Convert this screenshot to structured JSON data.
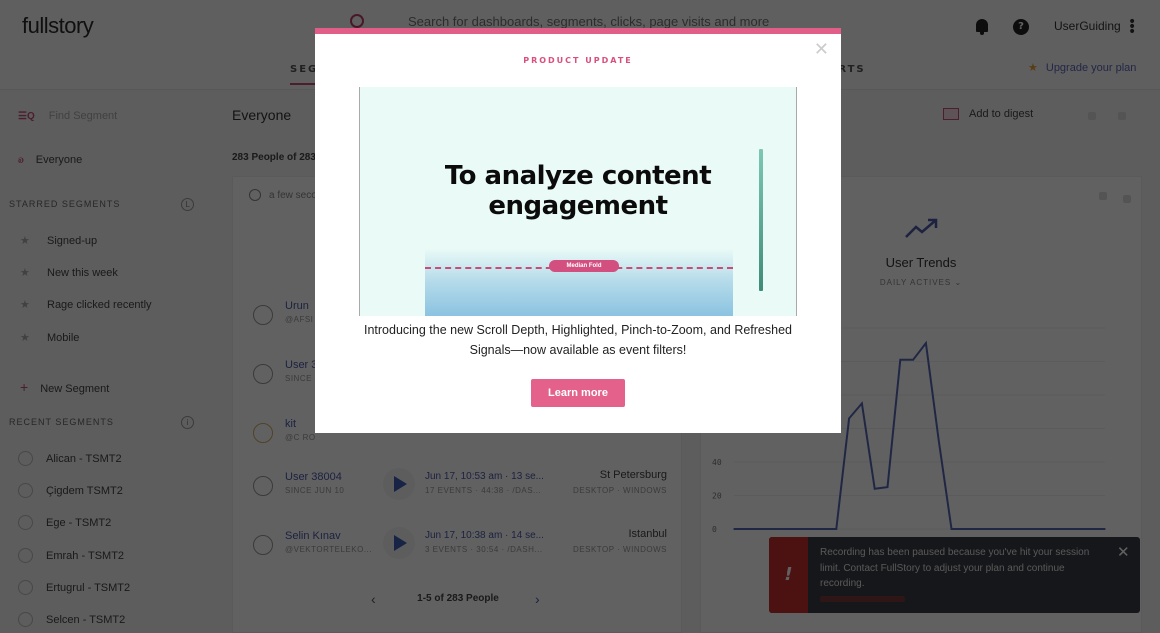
{
  "header": {
    "logo": "fullstory",
    "search_placeholder": "Search for dashboards, segments, clicks, page visits and more",
    "user_name": "UserGuiding",
    "tabs": [
      {
        "label": "SEGMENTS",
        "active": true
      },
      {
        "label": "REPORTS",
        "active": false
      }
    ],
    "upgrade_label": "Upgrade your plan"
  },
  "sidebar": {
    "find_placeholder": "Find Segment",
    "everyone_label": "Everyone",
    "starred_heading": "STARRED SEGMENTS",
    "starred": [
      "Signed-up",
      "New this week",
      "Rage clicked recently",
      "Mobile"
    ],
    "new_segment_label": "New Segment",
    "recent_heading": "RECENT SEGMENTS",
    "recent": [
      "Alican - TSMT2",
      "Çigdem TSMT2",
      "Ege - TSMT2",
      "Emrah - TSMT2",
      "Ertugrul - TSMT2",
      "Selcen - TSMT2"
    ]
  },
  "main": {
    "segment_title": "Everyone",
    "people_count": "283 People of 283",
    "last_updated": "a few seconds ago",
    "rows": [
      {
        "name": "Urun",
        "sub": "@AFSI",
        "time": "",
        "events": "",
        "city": "",
        "device": ""
      },
      {
        "name": "User 3",
        "sub": "SINCE J",
        "time": "",
        "events": "",
        "city": "",
        "device": ""
      },
      {
        "name": "kit",
        "sub": "@C RO",
        "time": "",
        "events": "",
        "city": "",
        "device": ""
      },
      {
        "name": "User 38004",
        "sub": "SINCE JUN 10",
        "time": "Jun 17, 10:53 am · 13 se...",
        "events": "17 EVENTS · 44:38 · /DAS...",
        "city": "St Petersburg",
        "device": "DESKTOP · WINDOWS"
      },
      {
        "name": "Selin Kınav",
        "sub": "@VEKTORTELEKO...",
        "time": "Jun 17, 10:38 am · 14 se...",
        "events": "3 EVENTS · 30:54 · /DASH...",
        "city": "Istanbul",
        "device": "DESKTOP · WINDOWS"
      }
    ],
    "pager_label": "1-5 of 283 People"
  },
  "right": {
    "digest_label": "Add to digest",
    "trend_title": "User Trends",
    "trend_metric": "DAILY ACTIVES"
  },
  "chart_data": {
    "type": "line",
    "title": "User Trends",
    "subtitle": "DAILY ACTIVES",
    "ylabel": "",
    "xlabel": "",
    "y_ticks": [
      0,
      20,
      40
    ],
    "ylim": [
      0,
      120
    ],
    "grid": true,
    "series": [
      {
        "name": "Daily Actives",
        "color": "#5566b5",
        "values": [
          0,
          0,
          0,
          0,
          0,
          0,
          0,
          0,
          0,
          66,
          75,
          24,
          25,
          101,
          101,
          111,
          53,
          0,
          0,
          0,
          0,
          0,
          0,
          0,
          0,
          0,
          0,
          0,
          0,
          0
        ]
      }
    ]
  },
  "notification": {
    "message": "Recording has been paused because you've hit your session limit. Contact FullStory to adjust your plan and continue recording.",
    "icon": "!"
  },
  "modal": {
    "kicker": "PRODUCT UPDATE",
    "hero_title_line1": "To analyze content",
    "hero_title_line2": "engagement",
    "hero_fold_label": "Median Fold",
    "body": "Introducing the new Scroll Depth, Highlighted, Pinch-to-Zoom, and Refreshed Signals—now available as event filters!",
    "cta_label": "Learn more",
    "accent": "#e15e88"
  }
}
